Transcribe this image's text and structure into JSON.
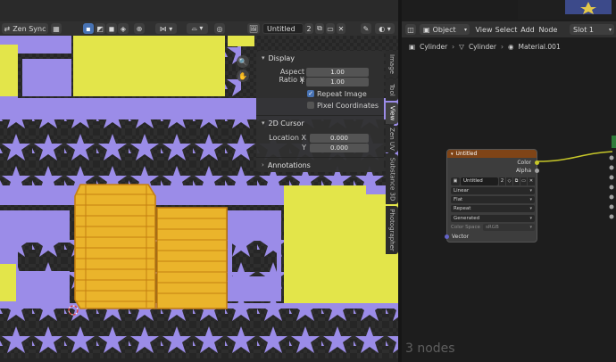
{
  "uv_editor": {
    "header": {
      "sync_label": "Zen Sync",
      "image_name": "Untitled",
      "user_count": "2"
    },
    "npanel": {
      "display": {
        "title": "Display",
        "aspect_ratio_label": "Aspect Ratio X",
        "aspect_y_label": "Y",
        "aspect_x_value": "1.00",
        "aspect_y_value": "1.00",
        "repeat_image_label": "Repeat Image",
        "repeat_image_checked": true,
        "pixel_coords_label": "Pixel Coordinates",
        "pixel_coords_checked": false
      },
      "cursor2d": {
        "title": "2D Cursor",
        "location_x_label": "Location X",
        "location_y_label": "Y",
        "location_x_value": "0.000",
        "location_y_value": "0.000"
      },
      "annotations": {
        "title": "Annotations"
      }
    },
    "side_tabs": [
      "Image",
      "Tool",
      "View",
      "Zen UV",
      "Substance 3D",
      "Photographer"
    ],
    "active_tab": "View",
    "colors": {
      "uv_island": "#9b8ce8",
      "image_patch": "#e3e54a",
      "selected_face": "#e8b428",
      "selected_edge": "#c47f12"
    }
  },
  "node_editor": {
    "header": {
      "object_menu": "Object",
      "menus": [
        "View",
        "Select",
        "Add",
        "Node"
      ],
      "slot": "Slot 1"
    },
    "breadcrumb": [
      "Cylinder",
      "Cylinder",
      "Material.001"
    ],
    "image_node": {
      "title": "Untitled",
      "outputs": [
        "Color",
        "Alpha"
      ],
      "image_name": "Untitled",
      "user_count": "2",
      "interpolation": "Linear",
      "projection": "Flat",
      "extension": "Repeat",
      "source": "Generated",
      "color_space_label": "Color Space",
      "color_space_value": "sRGB",
      "input_vector": "Vector"
    },
    "node_count": "3 nodes",
    "colors": {
      "node_header": "#7f4417",
      "socket_color": "#c7c729",
      "socket_vector": "#6363c7"
    }
  }
}
